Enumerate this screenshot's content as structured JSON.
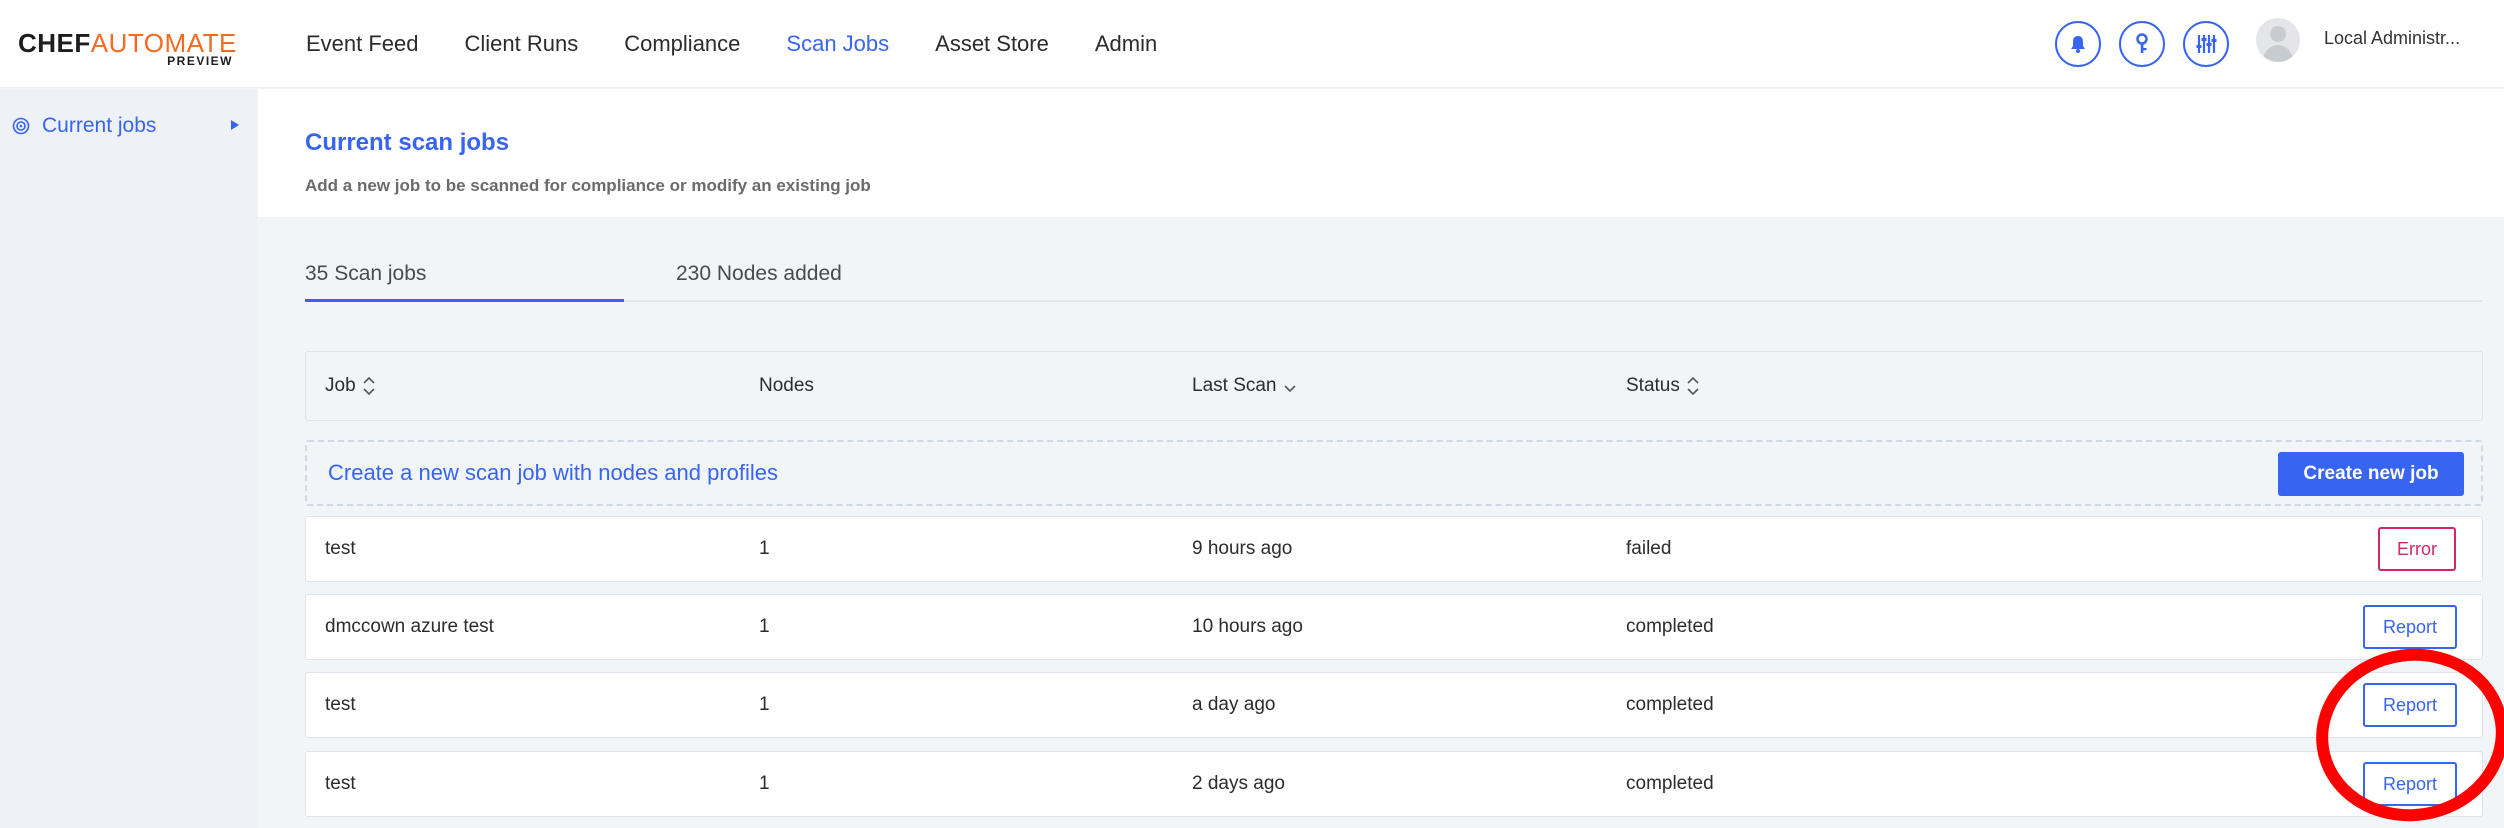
{
  "brand": {
    "name_part1": "CHEF",
    "name_part2": "AUTOMATE",
    "edition": "PREVIEW",
    "accent_color": "#f26b21"
  },
  "nav": {
    "items": [
      {
        "label": "Event Feed",
        "active": false
      },
      {
        "label": "Client Runs",
        "active": false
      },
      {
        "label": "Compliance",
        "active": false
      },
      {
        "label": "Scan Jobs",
        "active": true
      },
      {
        "label": "Asset Store",
        "active": false
      },
      {
        "label": "Admin",
        "active": false
      }
    ],
    "icons": [
      "bell-icon",
      "key-icon",
      "sliders-icon"
    ],
    "user": {
      "name": "Local Administr..."
    }
  },
  "sidebar": {
    "items": [
      {
        "label": "Current jobs",
        "icon": "radar-icon"
      }
    ]
  },
  "page": {
    "title": "Current scan jobs",
    "subtitle": "Add a new job to be scanned for compliance or modify an existing job"
  },
  "tabs": [
    {
      "label": "35 Scan jobs",
      "active": true
    },
    {
      "label": "230 Nodes added",
      "active": false
    }
  ],
  "table": {
    "columns": [
      "Job",
      "Nodes",
      "Last Scan",
      "Status"
    ],
    "create_row": {
      "link_label": "Create a new scan job with nodes and profiles",
      "button_label": "Create new job"
    },
    "rows": [
      {
        "job": "test",
        "nodes": "1",
        "last_scan": "9 hours ago",
        "status": "failed",
        "action": "Error"
      },
      {
        "job": "dmccown azure test",
        "nodes": "1",
        "last_scan": "10 hours ago",
        "status": "completed",
        "action": "Report"
      },
      {
        "job": "test",
        "nodes": "1",
        "last_scan": "a day ago",
        "status": "completed",
        "action": "Report"
      },
      {
        "job": "test",
        "nodes": "1",
        "last_scan": "2 days ago",
        "status": "completed",
        "action": "Report"
      }
    ]
  },
  "colors": {
    "primary": "#3864f2",
    "error": "#d0266b",
    "annotation": "#ff0000"
  }
}
